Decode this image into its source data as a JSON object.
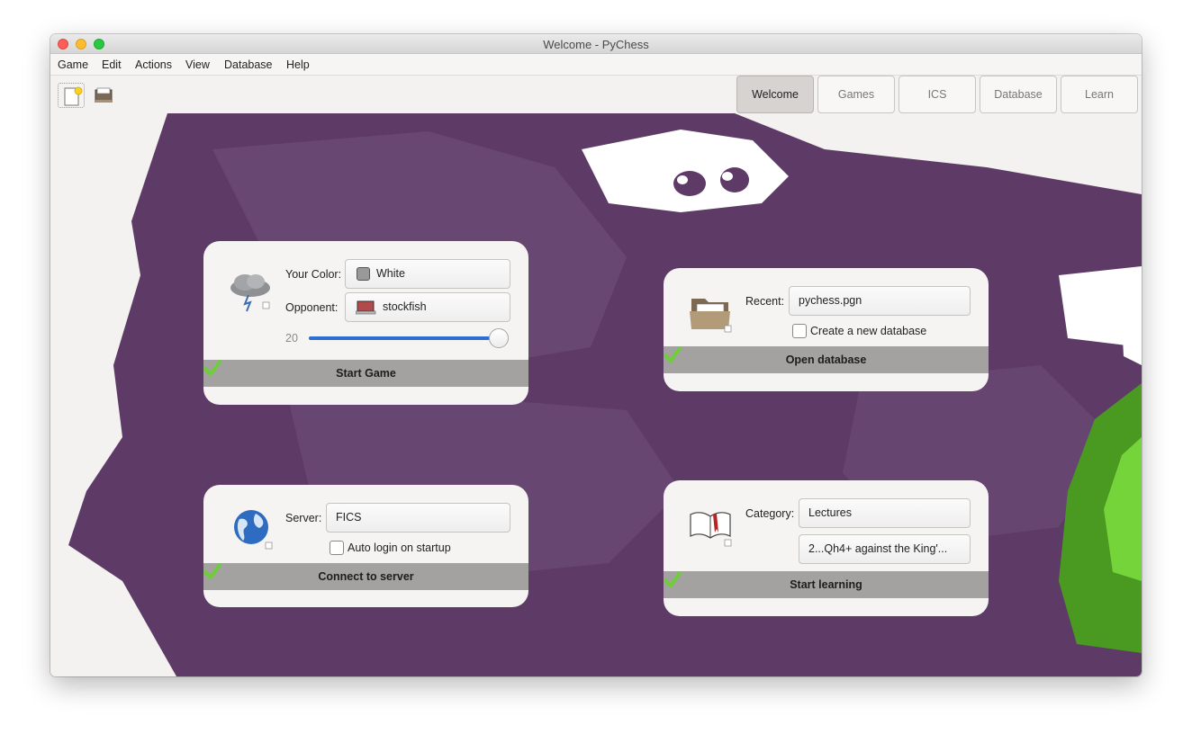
{
  "window": {
    "title": "Welcome - PyChess"
  },
  "menu": [
    "Game",
    "Edit",
    "Actions",
    "View",
    "Database",
    "Help"
  ],
  "toolbar": {
    "new_icon": "new-game-icon",
    "open_icon": "open-game-icon"
  },
  "tabs": [
    {
      "label": "Welcome",
      "active": true
    },
    {
      "label": "Games",
      "active": false
    },
    {
      "label": "ICS",
      "active": false
    },
    {
      "label": "Database",
      "active": false
    },
    {
      "label": "Learn",
      "active": false
    }
  ],
  "play_card": {
    "icon": "storm-cloud-icon",
    "color_label": "Your Color:",
    "color_value": "White",
    "opponent_label": "Opponent:",
    "opponent_value": "stockfish",
    "strength_value": "20",
    "strength_fraction": 1.0,
    "action": "Start Game"
  },
  "database_card": {
    "icon": "folder-icon",
    "recent_label": "Recent:",
    "recent_value": "pychess.pgn",
    "create_label": "Create a new database",
    "create_checked": false,
    "action": "Open database"
  },
  "server_card": {
    "icon": "globe-icon",
    "server_label": "Server:",
    "server_value": "FICS",
    "autologin_label": "Auto login on startup",
    "autologin_checked": false,
    "action": "Connect to server"
  },
  "learn_card": {
    "icon": "book-icon",
    "category_label": "Category:",
    "category_value": "Lectures",
    "lecture_value": "2...Qh4+ against the King'...",
    "action": "Start learning"
  },
  "colors": {
    "accent": "#2c6fd1",
    "background_art": "#6a4a73",
    "green_art": "#59b62b"
  }
}
